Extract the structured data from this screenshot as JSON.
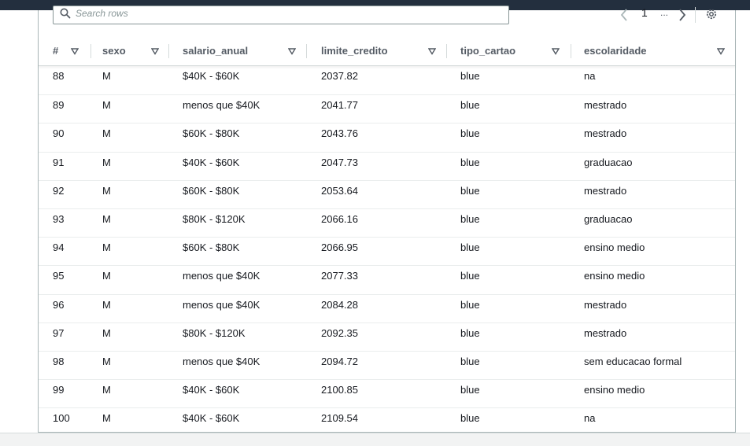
{
  "search": {
    "placeholder": "Search rows"
  },
  "pagination": {
    "current_page": "1",
    "ellipsis": "..."
  },
  "columns": [
    {
      "key": "idx",
      "label": "#"
    },
    {
      "key": "sexo",
      "label": "sexo"
    },
    {
      "key": "salario_anual",
      "label": "salario_anual"
    },
    {
      "key": "limite_credito",
      "label": "limite_credito"
    },
    {
      "key": "tipo_cartao",
      "label": "tipo_cartao"
    },
    {
      "key": "escolaridade",
      "label": "escolaridade"
    }
  ],
  "rows": [
    [
      "88",
      "M",
      "$40K - $60K",
      "2037.82",
      "blue",
      "na"
    ],
    [
      "89",
      "M",
      "menos que $40K",
      "2041.77",
      "blue",
      "mestrado"
    ],
    [
      "90",
      "M",
      "$60K - $80K",
      "2043.76",
      "blue",
      "mestrado"
    ],
    [
      "91",
      "M",
      "$40K - $60K",
      "2047.73",
      "blue",
      "graduacao"
    ],
    [
      "92",
      "M",
      "$60K - $80K",
      "2053.64",
      "blue",
      "mestrado"
    ],
    [
      "93",
      "M",
      "$80K - $120K",
      "2066.16",
      "blue",
      "graduacao"
    ],
    [
      "94",
      "M",
      "$60K - $80K",
      "2066.95",
      "blue",
      "ensino medio"
    ],
    [
      "95",
      "M",
      "menos que $40K",
      "2077.33",
      "blue",
      "ensino medio"
    ],
    [
      "96",
      "M",
      "menos que $40K",
      "2084.28",
      "blue",
      "mestrado"
    ],
    [
      "97",
      "M",
      "$80K - $120K",
      "2092.35",
      "blue",
      "mestrado"
    ],
    [
      "98",
      "M",
      "menos que $40K",
      "2094.72",
      "blue",
      "sem educacao formal"
    ],
    [
      "99",
      "M",
      "$40K - $60K",
      "2100.85",
      "blue",
      "ensino medio"
    ],
    [
      "100",
      "M",
      "$40K - $60K",
      "2109.54",
      "blue",
      "na"
    ]
  ],
  "icons": {
    "search": "search-icon",
    "prev": "chevron-left-icon",
    "next": "chevron-right-icon",
    "settings": "gear-icon",
    "sort": "sort-down-icon"
  },
  "colors": {
    "topbar": "#232f3e",
    "text": "#16191f",
    "header_text": "#545b64",
    "border": "#aab7b8"
  }
}
